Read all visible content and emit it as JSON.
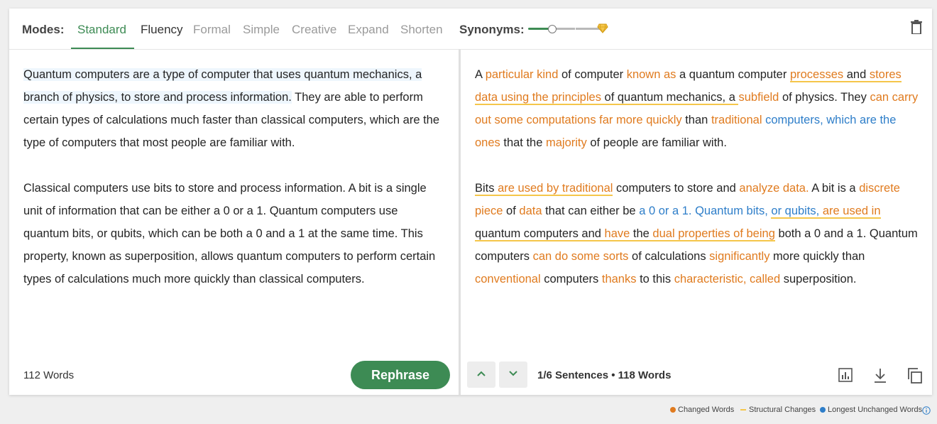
{
  "header": {
    "modes_label": "Modes:",
    "modes": [
      "Standard",
      "Fluency",
      "Formal",
      "Simple",
      "Creative",
      "Expand",
      "Shorten"
    ],
    "active_mode": "Standard",
    "synonyms_label": "Synonyms:",
    "synonyms_level": 0.25
  },
  "left": {
    "p1_hl": "Quantum computers are a type of computer that uses quantum mechanics, a branch of physics, to store and process information.",
    "p1_rest": " They are able to perform certain types of calculations much faster than classical computers, which are the type of computers that most people are familiar with.",
    "p2": "Classical computers use bits to store and process information. A bit is a single unit of information that can be either a 0 or a 1. Quantum computers use quantum bits, or qubits, which can be both a 0 and a 1 at the same time. This property, known as superposition, allows quantum computers to perform certain types of calculations much more quickly than classical computers.",
    "word_count": "112 Words",
    "rephrase_label": "Rephrase"
  },
  "right": {
    "paragraphs": [
      [
        {
          "t": "A ",
          "k": "n"
        },
        {
          "t": "particular kind",
          "k": "c"
        },
        {
          "t": " of computer ",
          "k": "n"
        },
        {
          "t": "known as",
          "k": "c"
        },
        {
          "t": " a quantum computer ",
          "k": "n"
        },
        {
          "t": "processes",
          "k": "cs"
        },
        {
          "t": " and ",
          "k": "s"
        },
        {
          "t": "stores data using the principles",
          "k": "cs"
        },
        {
          "t": " of quantum mechanics, a ",
          "k": "s"
        },
        {
          "t": "subfield",
          "k": "c"
        },
        {
          "t": " of physics. They ",
          "k": "n"
        },
        {
          "t": "can carry out some computations far more quickly",
          "k": "c"
        },
        {
          "t": " than ",
          "k": "n"
        },
        {
          "t": "traditional",
          "k": "c"
        },
        {
          "t": " computers, which are the ",
          "k": "b"
        },
        {
          "t": "ones",
          "k": "c"
        },
        {
          "t": " that the ",
          "k": "n"
        },
        {
          "t": "majority",
          "k": "c"
        },
        {
          "t": " of people are familiar with.",
          "k": "n"
        }
      ],
      [
        {
          "t": "Bits ",
          "k": "s"
        },
        {
          "t": "are used by traditional",
          "k": "cs"
        },
        {
          "t": " computers to store and ",
          "k": "n"
        },
        {
          "t": "analyze",
          "k": "c"
        },
        {
          "t": " data.",
          "k": "c"
        },
        {
          "t": " A bit is a ",
          "k": "n"
        },
        {
          "t": "discrete piece",
          "k": "c"
        },
        {
          "t": " of ",
          "k": "n"
        },
        {
          "t": "data",
          "k": "c"
        },
        {
          "t": " that can either be ",
          "k": "n"
        },
        {
          "t": "a 0 or a 1. Quantum bits, ",
          "k": "b"
        },
        {
          "t": "or qubits,",
          "k": "bs"
        },
        {
          "t": " ",
          "k": "s"
        },
        {
          "t": "are used in",
          "k": "cs"
        },
        {
          "t": " quantum computers and ",
          "k": "s"
        },
        {
          "t": "have",
          "k": "cs"
        },
        {
          "t": " the ",
          "k": "s"
        },
        {
          "t": "dual properties of being",
          "k": "cs"
        },
        {
          "t": " both a 0 and a 1. Quantum computers ",
          "k": "n"
        },
        {
          "t": "can do some sorts",
          "k": "c"
        },
        {
          "t": " of calculations ",
          "k": "n"
        },
        {
          "t": "significantly",
          "k": "c"
        },
        {
          "t": " more quickly than ",
          "k": "n"
        },
        {
          "t": "conventional",
          "k": "c"
        },
        {
          "t": " computers ",
          "k": "n"
        },
        {
          "t": "thanks",
          "k": "c"
        },
        {
          "t": " to this ",
          "k": "n"
        },
        {
          "t": "characteristic, called",
          "k": "c"
        },
        {
          "t": " superposition.",
          "k": "n"
        }
      ]
    ],
    "sentence_index": "1",
    "sentence_total": "/6 Sentences",
    "word_count": "118 Words"
  },
  "legend": {
    "changed": "Changed Words",
    "structural": "Structural Changes",
    "longest": "Longest Unchanged Words"
  },
  "colors": {
    "accent": "#3d8b54",
    "changed": "#e07b1f",
    "structural": "#f5c64a",
    "unchanged": "#2e7ec9"
  }
}
